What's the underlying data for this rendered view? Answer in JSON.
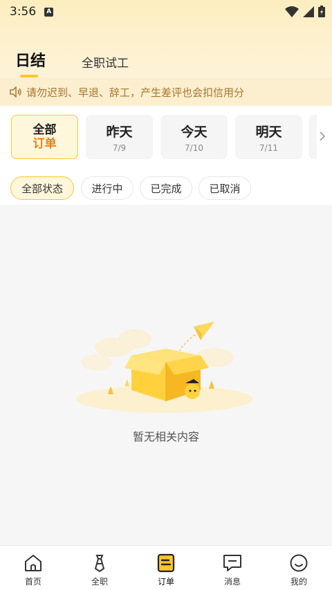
{
  "status_bar": {
    "time": "3:56",
    "a_badge": "A"
  },
  "tabs": [
    {
      "label": "日结",
      "active": true
    },
    {
      "label": "全职试工",
      "active": false
    }
  ],
  "notice": {
    "text": "请勿迟到、早退、辞工，产生差评也会扣信用分"
  },
  "dates": [
    {
      "line1": "全部",
      "line2": "订单",
      "active": true
    },
    {
      "line1": "昨天",
      "line2": "7/9",
      "active": false
    },
    {
      "line1": "今天",
      "line2": "7/10",
      "active": false
    },
    {
      "line1": "明天",
      "line2": "7/11",
      "active": false
    }
  ],
  "filters": [
    {
      "label": "全部状态",
      "active": true
    },
    {
      "label": "进行中",
      "active": false
    },
    {
      "label": "已完成",
      "active": false
    },
    {
      "label": "已取消",
      "active": false
    }
  ],
  "empty": {
    "text": "暂无相关内容"
  },
  "bottom_nav": [
    {
      "label": "首页",
      "icon": "home-icon"
    },
    {
      "label": "全职",
      "icon": "tie-icon"
    },
    {
      "label": "订单",
      "icon": "order-icon",
      "active": true
    },
    {
      "label": "消息",
      "icon": "message-icon"
    },
    {
      "label": "我的",
      "icon": "smile-icon"
    }
  ],
  "colors": {
    "accent": "#ffc629",
    "accent_orange": "#f07f0d",
    "notice_text": "#a8752d"
  }
}
